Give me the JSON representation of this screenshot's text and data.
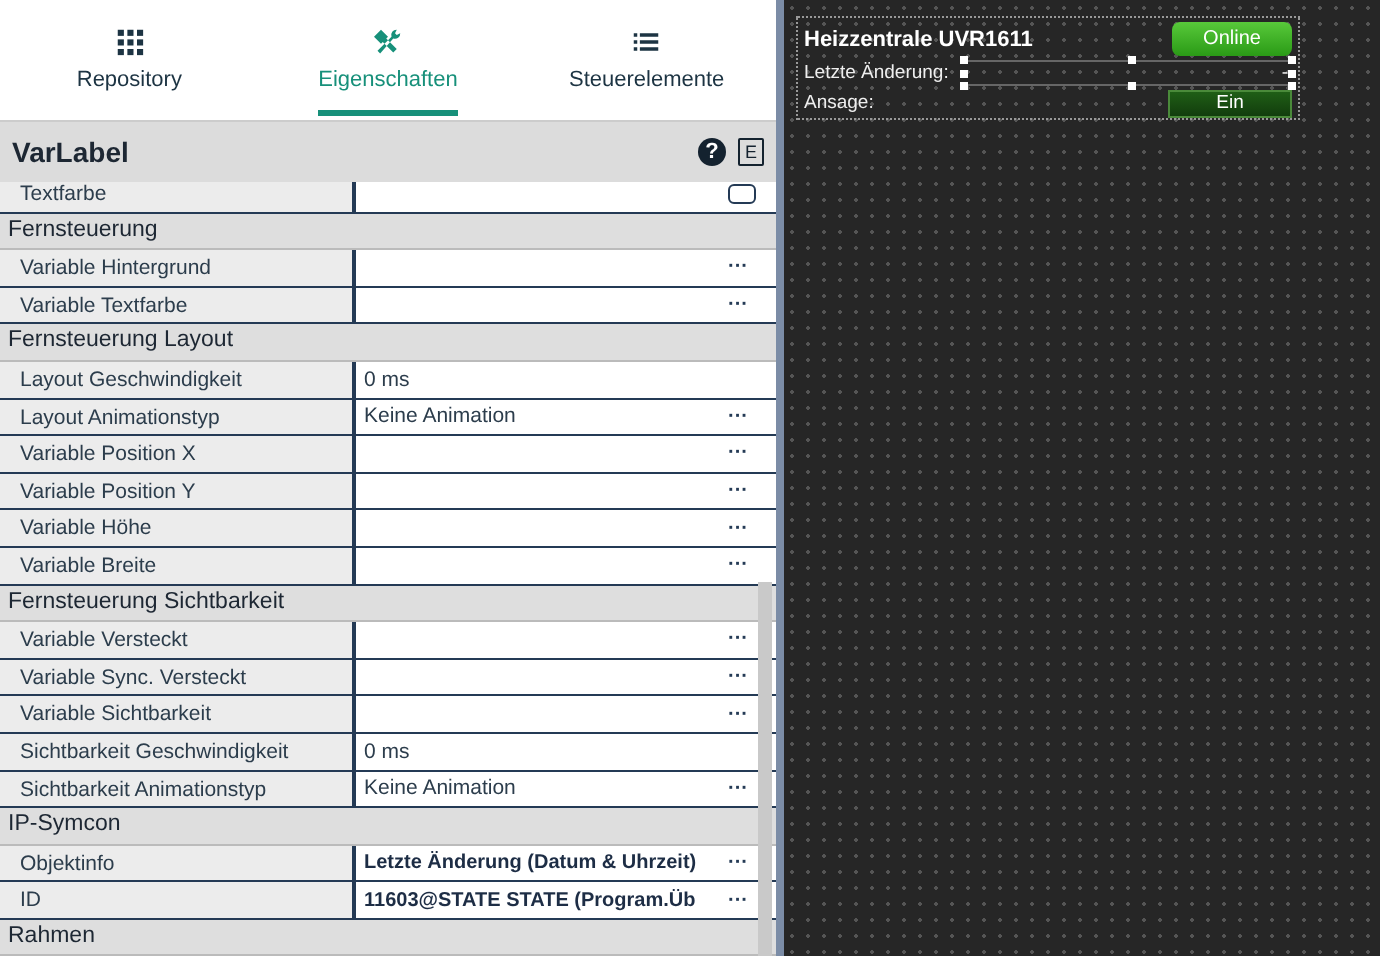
{
  "tabs": [
    {
      "label": "Repository",
      "selected": false
    },
    {
      "label": "Eigenschaften",
      "selected": true
    },
    {
      "label": "Steuerelemente",
      "selected": false
    }
  ],
  "panel": {
    "title": "VarLabel",
    "help": "?",
    "expert": "E"
  },
  "rows": [
    {
      "kind": "color",
      "label": "Textfarbe",
      "value": ""
    },
    {
      "kind": "group",
      "label": "Fernsteuerung"
    },
    {
      "kind": "prop",
      "label": "Variable Hintergrund",
      "value": "",
      "action": "···"
    },
    {
      "kind": "prop",
      "label": "Variable Textfarbe",
      "value": "",
      "action": "···"
    },
    {
      "kind": "group",
      "label": "Fernsteuerung Layout"
    },
    {
      "kind": "prop",
      "label": "Layout Geschwindigkeit",
      "value": "0 ms"
    },
    {
      "kind": "prop",
      "label": "Layout Animationstyp",
      "value": "Keine Animation",
      "action": "···"
    },
    {
      "kind": "prop",
      "label": "Variable Position X",
      "value": "",
      "action": "···"
    },
    {
      "kind": "prop",
      "label": "Variable Position Y",
      "value": "",
      "action": "···"
    },
    {
      "kind": "prop",
      "label": "Variable Höhe",
      "value": "",
      "action": "···"
    },
    {
      "kind": "prop",
      "label": "Variable Breite",
      "value": "",
      "action": "···"
    },
    {
      "kind": "group",
      "label": "Fernsteuerung Sichtbarkeit"
    },
    {
      "kind": "prop",
      "label": "Variable Versteckt",
      "value": "",
      "action": "···"
    },
    {
      "kind": "prop",
      "label": "Variable Sync. Versteckt",
      "value": "",
      "action": "···"
    },
    {
      "kind": "prop",
      "label": "Variable Sichtbarkeit",
      "value": "",
      "action": "···"
    },
    {
      "kind": "prop",
      "label": "Sichtbarkeit Geschwindigkeit",
      "value": "0 ms"
    },
    {
      "kind": "prop",
      "label": "Sichtbarkeit Animationstyp",
      "value": "Keine Animation",
      "action": "···"
    },
    {
      "kind": "group",
      "label": "IP-Symcon"
    },
    {
      "kind": "prop",
      "label": "Objektinfo",
      "value": "Letzte Änderung (Datum & Uhrzeit)",
      "bold": true,
      "action": "···"
    },
    {
      "kind": "prop",
      "label": "ID",
      "value": "11603@STATE STATE (Program.Üb",
      "bold": true,
      "action": "···"
    },
    {
      "kind": "group",
      "label": "Rahmen"
    }
  ],
  "widget": {
    "title": "Heizzentrale UVR1611",
    "status": "Online",
    "change_label": "Letzte Änderung:",
    "change_value": "-",
    "announce_label": "Ansage:",
    "announce_value": "Ein"
  }
}
